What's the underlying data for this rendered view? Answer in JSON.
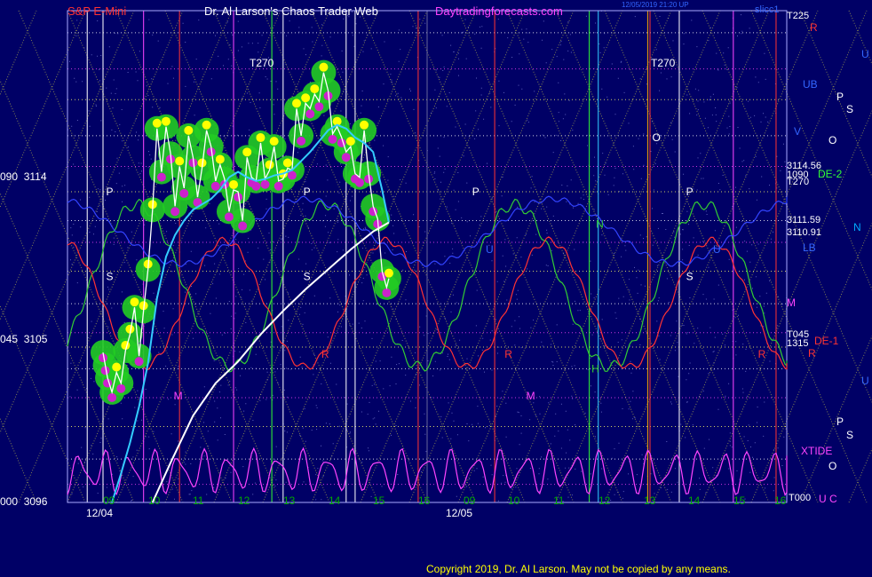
{
  "header": {
    "instrument": "S&P E-Mini",
    "site_title": "Dr. Al Larson's Chaos Trader Web",
    "site_url": "Daytradingforecasts.com",
    "update_time": "12/05/2019 21:20 UP",
    "right_label": "slicc1"
  },
  "copyright": "Copyright 2019, Dr. Al Larson. May not be copied by any means.",
  "chart_data": {
    "type": "line",
    "title": "S&P E-Mini",
    "y_axis": {
      "ylim": [
        3096,
        3125
      ],
      "ticks": [
        {
          "left": "000",
          "value": 3096
        },
        {
          "left": "045",
          "value": 3105
        },
        {
          "left": "090",
          "value": 3114
        }
      ]
    },
    "x_axis": {
      "session_1_date": "12/04",
      "session_2_date": "12/05",
      "session_1_hours": [
        "09",
        "10",
        "11",
        "12",
        "13",
        "14",
        "15",
        "16"
      ],
      "session_2_hours": [
        "09",
        "10",
        "11",
        "12",
        "13",
        "14",
        "15",
        "16"
      ]
    },
    "right_levels": [
      {
        "text": "T225",
        "value": 3124,
        "color": "#ffffff"
      },
      {
        "text": "3114.56",
        "value": 3114.56,
        "color": "#ffffff"
      },
      {
        "text": "1090",
        "value": 3114.2,
        "color": "#ffffff"
      },
      {
        "text": "T270",
        "value": 3113.6,
        "color": "#ffffff"
      },
      {
        "text": "3111.59",
        "value": 3111.59,
        "color": "#ffffff"
      },
      {
        "text": "3110.91",
        "value": 3110.91,
        "color": "#ffffff"
      },
      {
        "text": "T045",
        "value": 3105.1,
        "color": "#ffffff"
      },
      {
        "text": "1315",
        "value": 3104.6,
        "color": "#ffffff"
      },
      {
        "text": "T000",
        "value": 3096,
        "color": "#ffffff"
      }
    ],
    "chart_labels": [
      {
        "text": "T270",
        "value": 3121,
        "color": "#ffffff"
      },
      {
        "text": "T270",
        "value": 3121,
        "color": "#ffffff"
      }
    ],
    "tide_labels": [
      {
        "text": "UB",
        "value": 3119.3,
        "color": "#3366ff"
      },
      {
        "text": "V",
        "value": 3116.2,
        "color": "#3366ff"
      },
      {
        "text": "LB",
        "value": 3110.0,
        "color": "#3366ff"
      },
      {
        "text": "M",
        "value": 3107.0,
        "color": "#ff44ff"
      },
      {
        "text": "R",
        "value": 3104.0,
        "color": "#ff3333"
      },
      {
        "text": "R",
        "value": 3125.3,
        "color": "#ff3333"
      },
      {
        "text": "XTIDE",
        "value": 3099.0,
        "color": "#ff44ff"
      },
      {
        "text": "DE-2",
        "value": 3114.2,
        "color": "#33ff33"
      },
      {
        "text": "DE-1",
        "value": 3104.8,
        "color": "#ff3333"
      },
      {
        "text": "U",
        "value": 3096.0,
        "color": "#ff44ff"
      },
      {
        "text": "C",
        "value": 3096.0,
        "color": "#ff44ff"
      }
    ],
    "outer_labels": [
      {
        "text": "U",
        "value": 3122.7,
        "color": "#3366ff"
      },
      {
        "text": "P",
        "value": 3118.5,
        "color": "#ffffff"
      },
      {
        "text": "S",
        "value": 3118.0,
        "color": "#ffffff"
      },
      {
        "text": "O",
        "value": 3116.0,
        "color": "#ffffff"
      },
      {
        "text": "N",
        "value": 3111.2,
        "color": "#00aaff"
      },
      {
        "text": "U",
        "value": 3102.0,
        "color": "#3366ff"
      },
      {
        "text": "P",
        "value": 3100.8,
        "color": "#ffffff"
      },
      {
        "text": "S",
        "value": 3100.3,
        "color": "#ffffff"
      },
      {
        "text": "O",
        "value": 3098.6,
        "color": "#ffffff"
      }
    ],
    "session_markers": [
      {
        "text": "P",
        "x": 0.07,
        "value": 3113.0
      },
      {
        "text": "S",
        "x": 0.07,
        "value": 3108.3
      },
      {
        "text": "M",
        "x": 1.57,
        "value": 3101.7
      },
      {
        "text": "P",
        "x": 4.45,
        "value": 3113.0
      },
      {
        "text": "S",
        "x": 4.45,
        "value": 3108.3
      },
      {
        "text": "R",
        "x": 4.85,
        "value": 3104.0
      },
      {
        "text": "P",
        "x": 8.2,
        "value": 3113.0
      },
      {
        "text": "U",
        "x": 8.5,
        "value": 3109.8
      },
      {
        "text": "R",
        "x": 8.92,
        "value": 3104.0
      },
      {
        "text": "M",
        "x": 9.4,
        "value": 3101.7
      },
      {
        "text": "N",
        "x": 10.95,
        "value": 3111.2
      },
      {
        "text": "H",
        "x": 10.85,
        "value": 3103.2
      },
      {
        "text": "O",
        "x": 12.2,
        "value": 3116.0
      },
      {
        "text": "P",
        "x": 12.95,
        "value": 3113.0
      },
      {
        "text": "S",
        "x": 12.95,
        "value": 3108.3
      },
      {
        "text": "U",
        "x": 13.55,
        "value": 3109.8
      },
      {
        "text": "R",
        "x": 14.55,
        "value": 3104.0
      }
    ],
    "series": [
      {
        "name": "price",
        "color": "#ffffff",
        "x": [
          0.0,
          0.05,
          0.1,
          0.2,
          0.3,
          0.4,
          0.5,
          0.6,
          0.7,
          0.8,
          0.9,
          1.0,
          1.1,
          1.2,
          1.3,
          1.4,
          1.5,
          1.6,
          1.7,
          1.8,
          1.9,
          2.0,
          2.1,
          2.2,
          2.3,
          2.4,
          2.5,
          2.6,
          2.7,
          2.8,
          2.9,
          3.0,
          3.1,
          3.2,
          3.3,
          3.4,
          3.5,
          3.6,
          3.7,
          3.8,
          3.9,
          4.0,
          4.1,
          4.2,
          4.3,
          4.4,
          4.5,
          4.6,
          4.7,
          4.8,
          4.9,
          5.0,
          5.1,
          5.2,
          5.3,
          5.4,
          5.5,
          5.6,
          5.7,
          5.8,
          5.9,
          6.0,
          6.1,
          6.2,
          6.3,
          6.35
        ],
        "values": [
          3104.3,
          3103.6,
          3102.9,
          3102.1,
          3103.2,
          3102.6,
          3104.4,
          3105.3,
          3106.8,
          3104.1,
          3106.6,
          3108.9,
          3112.2,
          3116.7,
          3114.3,
          3116.8,
          3115.3,
          3112.4,
          3114.6,
          3113.4,
          3116.3,
          3115.1,
          3112.9,
          3114.5,
          3116.6,
          3115.7,
          3113.8,
          3114.7,
          3113.9,
          3112.1,
          3113.3,
          3113.2,
          3111.6,
          3115.1,
          3114.0,
          3113.8,
          3115.9,
          3113.9,
          3114.4,
          3115.7,
          3113.8,
          3113.9,
          3114.5,
          3114.4,
          3117.8,
          3116.3,
          3118.1,
          3117.8,
          3118.6,
          3118.2,
          3119.8,
          3118.8,
          3116.4,
          3116.8,
          3116.2,
          3115.4,
          3115.7,
          3114.2,
          3114.0,
          3116.6,
          3114.2,
          3112.4,
          3111.7,
          3108.8,
          3107.9,
          3108.4
        ]
      },
      {
        "name": "avg_fast",
        "color": "#33ccff",
        "x": [
          0.2,
          0.4,
          0.6,
          0.8,
          1.0,
          1.2,
          1.4,
          1.6,
          1.8,
          2.0,
          2.2,
          2.4,
          2.6,
          2.8,
          3.0,
          3.2,
          3.4,
          3.6,
          3.8,
          4.0,
          4.2,
          4.4,
          4.6,
          4.8,
          5.0,
          5.2,
          5.4,
          5.6,
          5.8,
          6.0,
          6.2,
          6.35
        ],
        "values": [
          3096.0,
          3097.6,
          3099.3,
          3101.3,
          3103.7,
          3107.3,
          3109.6,
          3110.8,
          3111.6,
          3112.2,
          3112.5,
          3112.8,
          3113.3,
          3114.0,
          3114.3,
          3114.0,
          3113.8,
          3113.9,
          3114.1,
          3114.2,
          3114.4,
          3114.9,
          3115.4,
          3116.0,
          3116.6,
          3116.9,
          3116.7,
          3116.2,
          3115.9,
          3115.4,
          3113.3,
          3111.5
        ]
      },
      {
        "name": "avg_slow",
        "color": "#ffffff",
        "x": [
          1.1,
          1.5,
          2.0,
          2.5,
          3.0,
          3.5,
          4.0,
          4.5,
          5.0,
          5.5,
          6.0,
          6.35
        ],
        "values": [
          3096.0,
          3098.2,
          3100.8,
          3102.6,
          3103.8,
          3105.3,
          3106.6,
          3107.8,
          3108.9,
          3110.0,
          3111.0,
          3111.5
        ]
      }
    ]
  }
}
